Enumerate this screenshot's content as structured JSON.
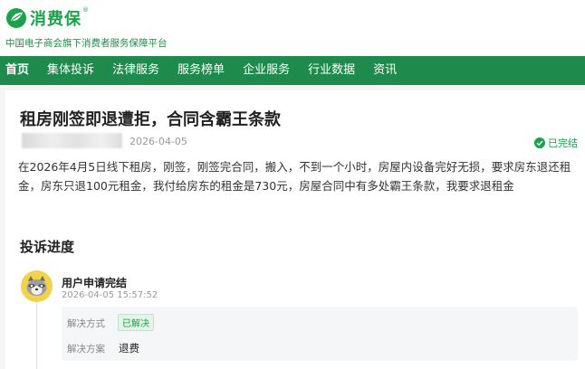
{
  "brand": {
    "name": "消费保",
    "reg": "®",
    "tagline": "中国电子商会旗下消费者服务保障平台",
    "color": "#1aa34a"
  },
  "nav": {
    "items": [
      "首页",
      "集体投诉",
      "法律服务",
      "服务榜单",
      "企业服务",
      "行业数据",
      "资讯"
    ],
    "bg": "#1e8b4c"
  },
  "complaint": {
    "title": "租房刚签即退遭拒，合同含霸王条款",
    "date": "2026-04-05",
    "status": "已完结",
    "description": "在2026年4月5日线下租房，刚签，刚签完合同，搬入，不到一个小时，房屋内设备完好无损，要求房东退还租金，房东只退100元租金，我付给房东的租金是730元，房屋合同中有多处霸王条款，我要求退租金"
  },
  "progress": {
    "section_title": "投诉进度",
    "event": {
      "title": "用户申请完结",
      "time": "2026-04-05 15:57:52",
      "method_label": "解决方式",
      "method_value": "已解决",
      "plan_label": "解决方案",
      "plan_value": "退费"
    }
  },
  "icons": [
    "leaf-logo-icon",
    "check-circle-icon",
    "raccoon-avatar-icon"
  ]
}
